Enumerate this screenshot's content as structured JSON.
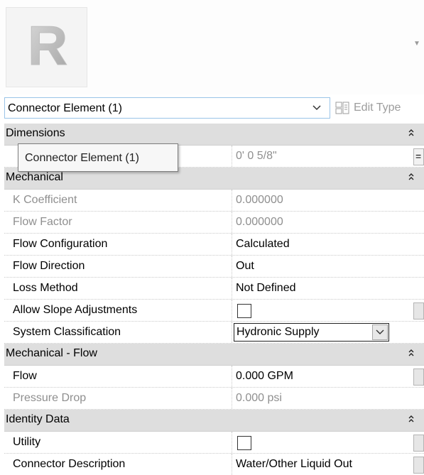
{
  "header": {
    "logo_letter": "R"
  },
  "selector": {
    "label": "Connector Element (1)",
    "edit_type_label": "Edit Type"
  },
  "tooltip": {
    "text": "Connector Element (1)"
  },
  "groups": {
    "dimensions": {
      "title": "Dimensions",
      "rows": [
        {
          "value": "0'  0 5/8\""
        }
      ]
    },
    "mechanical": {
      "title": "Mechanical",
      "rows": [
        {
          "name": "K Coefficient",
          "value": "0.000000"
        },
        {
          "name": "Flow Factor",
          "value": "0.000000"
        },
        {
          "name": "Flow Configuration",
          "value": "Calculated"
        },
        {
          "name": "Flow Direction",
          "value": "Out"
        },
        {
          "name": "Loss Method",
          "value": "Not Defined"
        },
        {
          "name": "Allow Slope Adjustments",
          "checked": false
        },
        {
          "name": "System Classification",
          "value": "Hydronic Supply"
        }
      ]
    },
    "mechanical_flow": {
      "title": "Mechanical - Flow",
      "rows": [
        {
          "name": "Flow",
          "value": "0.000 GPM"
        },
        {
          "name": "Pressure Drop",
          "value": "0.000 psi"
        }
      ]
    },
    "identity_data": {
      "title": "Identity Data",
      "rows": [
        {
          "name": "Utility",
          "checked": false
        },
        {
          "name": "Connector Description",
          "value": "Water/Other Liquid Out"
        }
      ]
    }
  },
  "side_button": {
    "label": "="
  },
  "colors": {
    "group_header": "#dedede",
    "disabled_text": "#8f8f8f",
    "selector_border": "#9ac4e8"
  },
  "icons": [
    "revit-logo-icon",
    "chevron-down-icon",
    "edit-type-icon",
    "collapse-icon",
    "dropdown-arrow-icon",
    "scroll-down-icon"
  ]
}
